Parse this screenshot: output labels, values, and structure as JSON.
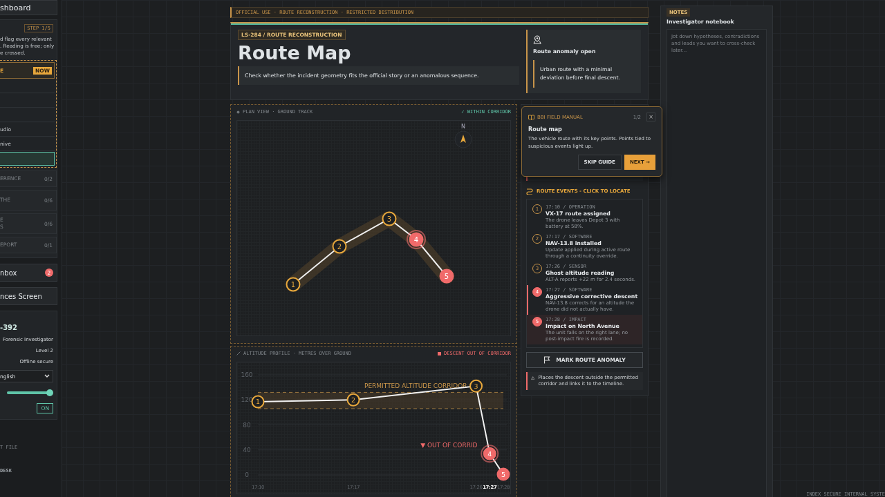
{
  "sidebar": {
    "dashboard": "shboard",
    "step": "STEP 1/5",
    "intro": "d flag every relevant\n. Reading is free; only\ne crossed.",
    "current": {
      "label": "E",
      "badge": "NOW"
    },
    "sub_items": [
      {
        "selected": false
      },
      {
        "selected": false
      },
      {
        "selected": false
      },
      {
        "label": "udio",
        "selected": false
      },
      {
        "label": "nive",
        "selected": false
      },
      {
        "selected": true
      }
    ],
    "sections": [
      {
        "lines": [
          "ERENCE"
        ],
        "count": "0/2"
      },
      {
        "lines": [
          "THE"
        ],
        "count": "0/6"
      },
      {
        "lines": [
          "E",
          "S"
        ],
        "count": "0/6"
      },
      {
        "lines": [
          "EPORT"
        ],
        "count": "0/1"
      }
    ],
    "inbox": {
      "label": "nbox",
      "badge": "2"
    },
    "evidence": "nces Screen",
    "profile": {
      "id": "-392",
      "rows": [
        "Forensic Investigator",
        "Level 2",
        "Offline secure"
      ],
      "language": "nglish",
      "volume": {
        "level": 0.92
      },
      "toggle": {
        "label": "ON",
        "on": true
      }
    },
    "footer": [
      "T FILE",
      "DESK"
    ]
  },
  "banner": "OFFICIAL USE · ROUTE RECONSTRUCTION · RESTRICTED DISTRIBUTION",
  "header": {
    "tag": "LS-284 / ROUTE RECONSTRUCTION",
    "title": "Route Map",
    "lead": "Check whether the incident geometry fits the official story or an anomalous sequence.",
    "status": {
      "title": "Route anomaly open",
      "text": "Urban route with a minimal deviation before final descent."
    }
  },
  "plan_view": {
    "title": "PLAN VIEW · GROUND TRACK",
    "status": "✓ WITHIN CORRIDOR",
    "compass": "N",
    "points": [
      {
        "label": "1",
        "alert": false,
        "selected": false
      },
      {
        "label": "2",
        "alert": false,
        "selected": false
      },
      {
        "label": "3",
        "alert": false,
        "selected": false
      },
      {
        "label": "4",
        "alert": true,
        "selected": true
      },
      {
        "label": "5",
        "alert": true,
        "selected": false
      }
    ]
  },
  "altitude": {
    "title": "ALTITUDE PROFILE · METRES OVER GROUND",
    "status": "DESCENT OUT OF CORRIDOR",
    "points": [
      {
        "label": "1",
        "alert": false,
        "selected": false
      },
      {
        "label": "2",
        "alert": false,
        "selected": false
      },
      {
        "label": "3",
        "alert": false,
        "selected": false
      },
      {
        "label": "4",
        "alert": true,
        "selected": true
      },
      {
        "label": "5",
        "alert": true,
        "selected": false
      }
    ],
    "chart_data": {
      "type": "line",
      "categories": [
        "17:10",
        "17:17",
        "17:26",
        "17:27",
        "17:28"
      ],
      "series": [
        {
          "color": "#f2f2f2",
          "marker": "o",
          "values": [
            117,
            120,
            142,
            34,
            1
          ]
        }
      ],
      "grid": true,
      "ylim": [
        0,
        160
      ],
      "yticks": [
        0,
        40,
        80,
        120,
        160
      ],
      "ref_lines": [
        {
          "axis": "y",
          "value": 132
        },
        {
          "axis": "y",
          "value": 106
        }
      ],
      "bands": [
        {
          "axis": "y",
          "from": 106,
          "to": 132,
          "label": "PERMITTED ALTITUDE CORRIDOR"
        }
      ],
      "annotations": [
        "▼ OUT OF CORRID"
      ]
    }
  },
  "guide": {
    "source": "BBI FIELD MANUAL",
    "page": "1/2",
    "close": "×",
    "title": "Route map",
    "text": "The vehicle route with its key points. Points tied to suspicious events light up.",
    "skip": "SKIP GUIDE",
    "next": "NEXT →"
  },
  "events": {
    "title": "ROUTE EVENTS - CLICK TO LOCATE",
    "items": [
      {
        "num": "1",
        "meta": "17:10 / OPERATION",
        "title": "VX-17 route assigned",
        "text": "The drone leaves Depot 3 with battery at 58%.",
        "kind": "normal",
        "selected": false
      },
      {
        "num": "2",
        "meta": "17:17 / SOFTWARE",
        "title": "NAV-13.8 installed",
        "text": "Update applied during active route through a continuity override.",
        "kind": "normal",
        "selected": false
      },
      {
        "num": "3",
        "meta": "17:26 / SENSOR",
        "title": "Ghost altitude reading",
        "text": "ALT-A reports +22 m for 2.4 seconds.",
        "kind": "normal",
        "selected": false
      },
      {
        "num": "4",
        "meta": "17:27 / SOFTWARE",
        "title": "Aggressive corrective descent",
        "text": "NAV-13.8 corrects for an altitude the drone did not actually have.",
        "kind": "alert",
        "selected": true
      },
      {
        "num": "5",
        "meta": "17:28 / IMPACT",
        "title": "Impact on North Avenue",
        "text": "The unit falls on the right lane; no post-impact fire is recorded.",
        "kind": "impact",
        "selected": false
      }
    ]
  },
  "mark_button": "MARK ROUTE ANOMALY",
  "mark_note": "Places the descent outside the permitted corridor and links it to the timeline.",
  "notes": {
    "tag": "NOTES",
    "title": "Investigator notebook",
    "placeholder": "Jot down hypotheses, contradictions and leads you want to cross-check later..."
  },
  "footer": "INDEX SECURE INTERNAL SYSTE"
}
